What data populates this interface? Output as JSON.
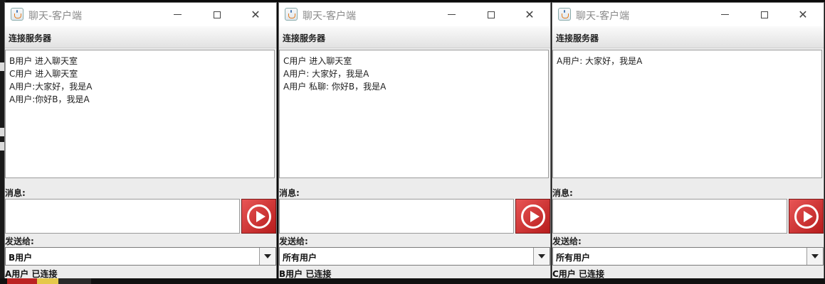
{
  "windows": [
    {
      "title": "聊天-客户端",
      "menu": "连接服务器",
      "messages": [
        "B用户 进入聊天室",
        "C用户 进入聊天室",
        "A用户:大家好，我是A",
        "A用户:你好B，我是A"
      ],
      "message_label": "消息:",
      "message_value": "",
      "send_to_label": "发送给:",
      "recipient": "B用户",
      "status": "A用户 已连接"
    },
    {
      "title": "聊天-客户端",
      "menu": "连接服务器",
      "messages": [
        "C用户 进入聊天室",
        "A用户: 大家好，我是A",
        "A用户 私聊: 你好B，我是A"
      ],
      "message_label": "消息:",
      "message_value": "",
      "send_to_label": "发送给:",
      "recipient": "所有用户",
      "status": "B用户 已连接"
    },
    {
      "title": "聊天-客户端",
      "menu": "连接服务器",
      "messages": [
        "A用户: 大家好，我是A"
      ],
      "message_label": "消息:",
      "message_value": "",
      "send_to_label": "发送给:",
      "recipient": "所有用户",
      "status": "C用户 已连接"
    }
  ],
  "colors": {
    "send_button": "#d32f2f",
    "title_text": "#8a8a8a"
  },
  "icons": [
    "java-cup-icon",
    "minimize-icon",
    "maximize-icon",
    "close-icon",
    "send-play-icon",
    "chevron-down-icon"
  ]
}
